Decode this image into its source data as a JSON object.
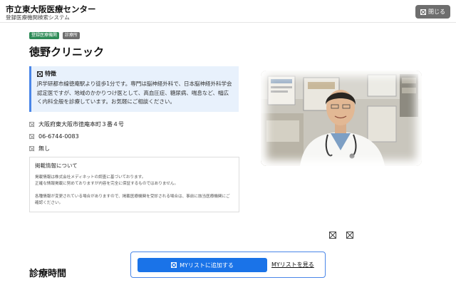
{
  "header": {
    "title": "市立東大阪医療センター",
    "subtitle": "登録医療機関検索システム",
    "close_label": "閉じる"
  },
  "badges": [
    "登録医療機関",
    "診療所"
  ],
  "clinic": {
    "name": "徳野クリニック",
    "feature_title": "特徴",
    "feature_text": "JR学研都市線徳庵駅より徒歩1分です。専門は脳神経外科で、日本脳神経外科学会認定医ですが、地域のかかりつけ医として、高血圧症、糖尿病、喘息など、幅広く内科全般を診療しています。お気軽にご相談ください。",
    "address": "大阪府東大阪市徳庵本町３番４号",
    "phone": "06-6744-0083",
    "other": "無し"
  },
  "notice": {
    "title": "掲載情報について",
    "line1": "掲載情報は株式会社メディネットの調査に基づいております。",
    "line2": "正確な情報掲載に努めておりますが内容を完全に保証するものではありません。",
    "line3": "各種情報が変更されている場合がありますので、掲載医療機関を受診される場合は、事前に該当医療機関にご確認ください。"
  },
  "section_title": "診療時間",
  "mylist": {
    "add_label": "MYリストに追加する",
    "view_label": "MYリストを見る"
  },
  "colors": {
    "accent": "#1a73e8",
    "feature_bg": "#e8f1fc",
    "badge_green": "#2e8b57",
    "badge_gray": "#6e6e6e"
  }
}
